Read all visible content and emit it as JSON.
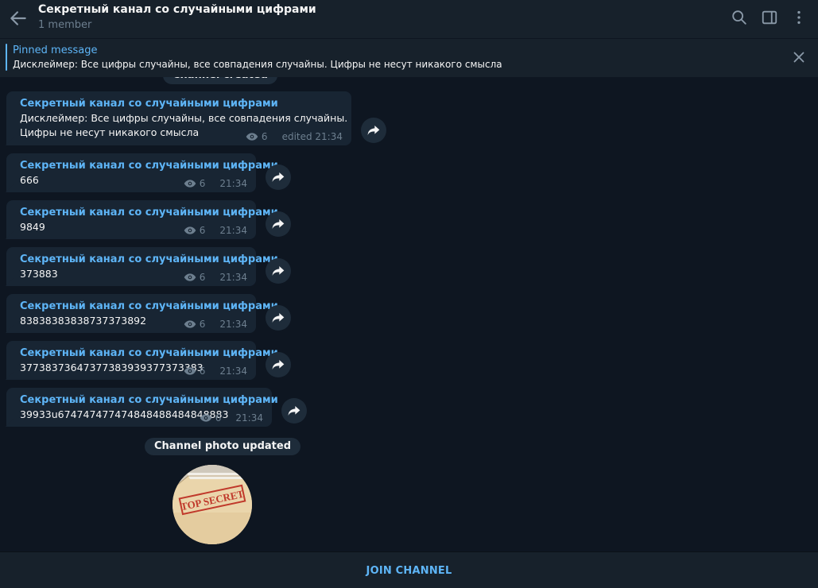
{
  "header": {
    "title": "Секретный канал со случайными цифрами",
    "subtitle": "1 member",
    "back_icon": "arrow-left-icon",
    "search_icon": "search-icon",
    "sidebar_icon": "sidebar-toggle-icon",
    "menu_icon": "more-vertical-icon"
  },
  "pinned": {
    "title": "Pinned message",
    "text": "Дисклеймер: Все цифры случайны, все совпадения случайны. Цифры не несут никакого смысла"
  },
  "service_top": "Channel created",
  "messages": [
    {
      "sender": "Секретный канал со случайными цифрами",
      "line1": "Дисклеймер: Все цифры случайны, все совпадения случайны.",
      "line2": "Цифры не несут никакого смысла",
      "views": "6",
      "time": "edited 21:34"
    },
    {
      "sender": "Секретный канал со случайными цифрами",
      "text": "666",
      "views": "6",
      "time": "21:34"
    },
    {
      "sender": "Секретный канал со случайными цифрами",
      "text": "9849",
      "views": "6",
      "time": "21:34"
    },
    {
      "sender": "Секретный канал со случайными цифрами",
      "text": "373883",
      "views": "6",
      "time": "21:34"
    },
    {
      "sender": "Секретный канал со случайными цифрами",
      "text": "83838383838737373892",
      "views": "6",
      "time": "21:34"
    },
    {
      "sender": "Секретный канал со случайными цифрами",
      "text": "37738373647377383939377373383",
      "views": "6",
      "time": "21:34"
    },
    {
      "sender": "Секретный канал со случайными цифрами",
      "text": "39933u674747477474848488484848883",
      "views": "6",
      "time": "21:34"
    }
  ],
  "service_photo": "Channel photo updated",
  "photo": {
    "stamp_text": "TOP SECRET"
  },
  "footer": {
    "join_label": "JOIN CHANNEL"
  },
  "colors": {
    "background": "#0e1621",
    "panel": "#17212b",
    "bubble": "#182533",
    "accent": "#5eb5f7",
    "muted": "#6d7f8f",
    "stamp": "#c0392b"
  }
}
